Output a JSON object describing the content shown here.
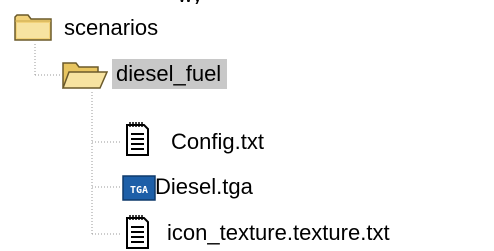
{
  "top_cropped_text": "wy",
  "tree": {
    "root": {
      "label": "scenarios",
      "icon": "closed-folder-icon"
    },
    "child_folder": {
      "label": "diesel_fuel",
      "icon": "open-folder-icon",
      "selected": true
    },
    "files": [
      {
        "label": "Config.txt",
        "icon": "text-file-icon"
      },
      {
        "label": "Diesel.tga",
        "icon": "tga-file-icon",
        "badge": "TGA"
      },
      {
        "label": "icon_texture.texture.txt",
        "icon": "text-file-icon"
      }
    ]
  },
  "colors": {
    "folder_yellow": "#f2d27a",
    "folder_outline": "#6b5a2a",
    "selection_bg": "#c8c8c8",
    "tree_line": "#9a9a9a",
    "tga_blue": "#1d5fa8"
  }
}
